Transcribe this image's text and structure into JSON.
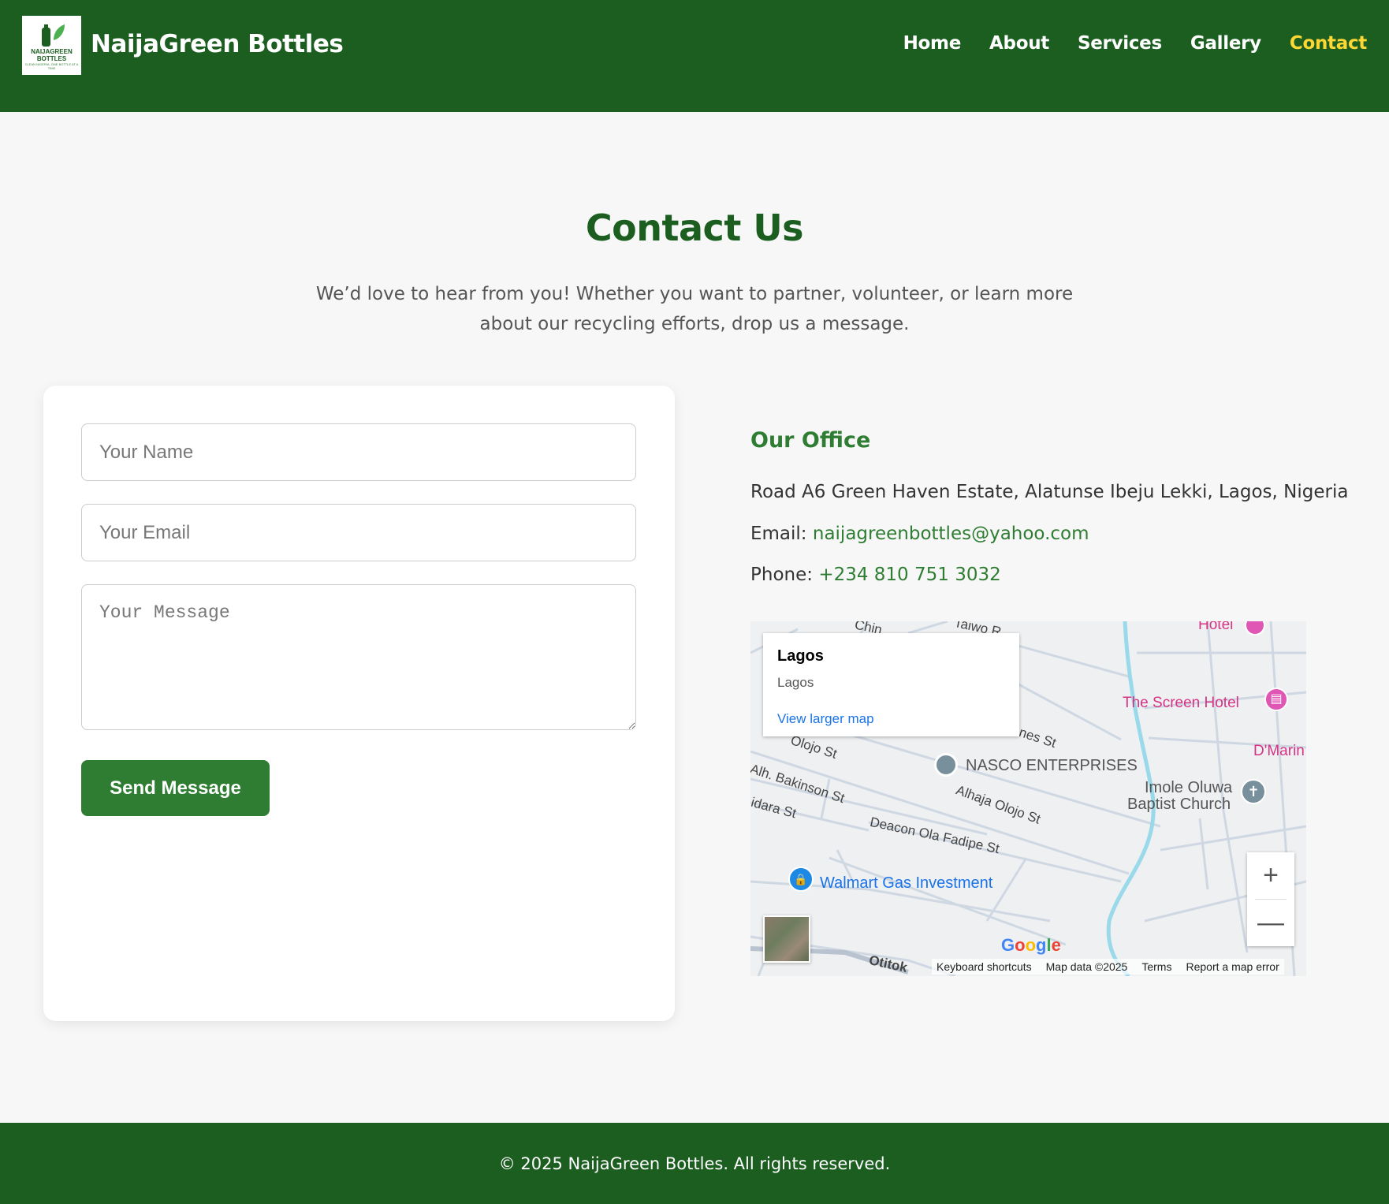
{
  "header": {
    "brand": "NaijaGreen Bottles",
    "logo_text": "NAIJAGREEN BOTTLES",
    "logo_tagline": "CLEAN NIGERIA, ONE BOTTLE AT A TIME",
    "nav": [
      {
        "label": "Home",
        "active": false
      },
      {
        "label": "About",
        "active": false
      },
      {
        "label": "Services",
        "active": false
      },
      {
        "label": "Gallery",
        "active": false
      },
      {
        "label": "Contact",
        "active": true
      }
    ]
  },
  "main": {
    "title": "Contact Us",
    "subtitle": "We’d love to hear from you! Whether you want to partner, volunteer, or learn more about our recycling efforts, drop us a message."
  },
  "form": {
    "name_placeholder": "Your Name",
    "email_placeholder": "Your Email",
    "message_placeholder": "Your Message",
    "submit_label": "Send Message"
  },
  "office": {
    "title": "Our Office",
    "address": "Road A6 Green Haven Estate, Alatunse Ibeju Lekki, Lagos, Nigeria",
    "email_label": "Email:",
    "email": "naijagreenbottles@yahoo.com",
    "phone_label": "Phone:",
    "phone": "+234 810 751 3032"
  },
  "map": {
    "popup_title": "Lagos",
    "popup_subtitle": "Lagos",
    "popup_link": "View larger map",
    "labels": {
      "hotel": "Hotel",
      "screen_hotel": "The Screen Hotel",
      "dmarin": "D'Marin",
      "nasco": "NASCO ENTERPRISES",
      "imole_1": "Imole Oluwa",
      "imole_2": "Baptist Church",
      "olojo": "Olojo St",
      "bakinson": "Alh. Bakinson St",
      "alhaja": "Alhaja Olojo St",
      "idara": "idara St",
      "deacon": "Deacon Ola Fadipe St",
      "walmart": "Walmart Gas Investment",
      "otitoko": "Otitok",
      "taiwo": "Taiwo R",
      "chin": "Chin",
      "nes": "nes St"
    },
    "google": "Google",
    "footer_links": [
      "Keyboard shortcuts",
      "Map data ©2025",
      "Terms",
      "Report a map error"
    ],
    "colors": {
      "poi_pink": "#d63384",
      "poi_blue": "#1a73e8",
      "river": "#9ad9ea"
    }
  },
  "footer": {
    "copyright": "© 2025 NaijaGreen Bottles. All rights reserved."
  },
  "colors": {
    "brand_green": "#1b5e20",
    "button_green": "#2e7d32",
    "nav_active": "#fdd835"
  }
}
